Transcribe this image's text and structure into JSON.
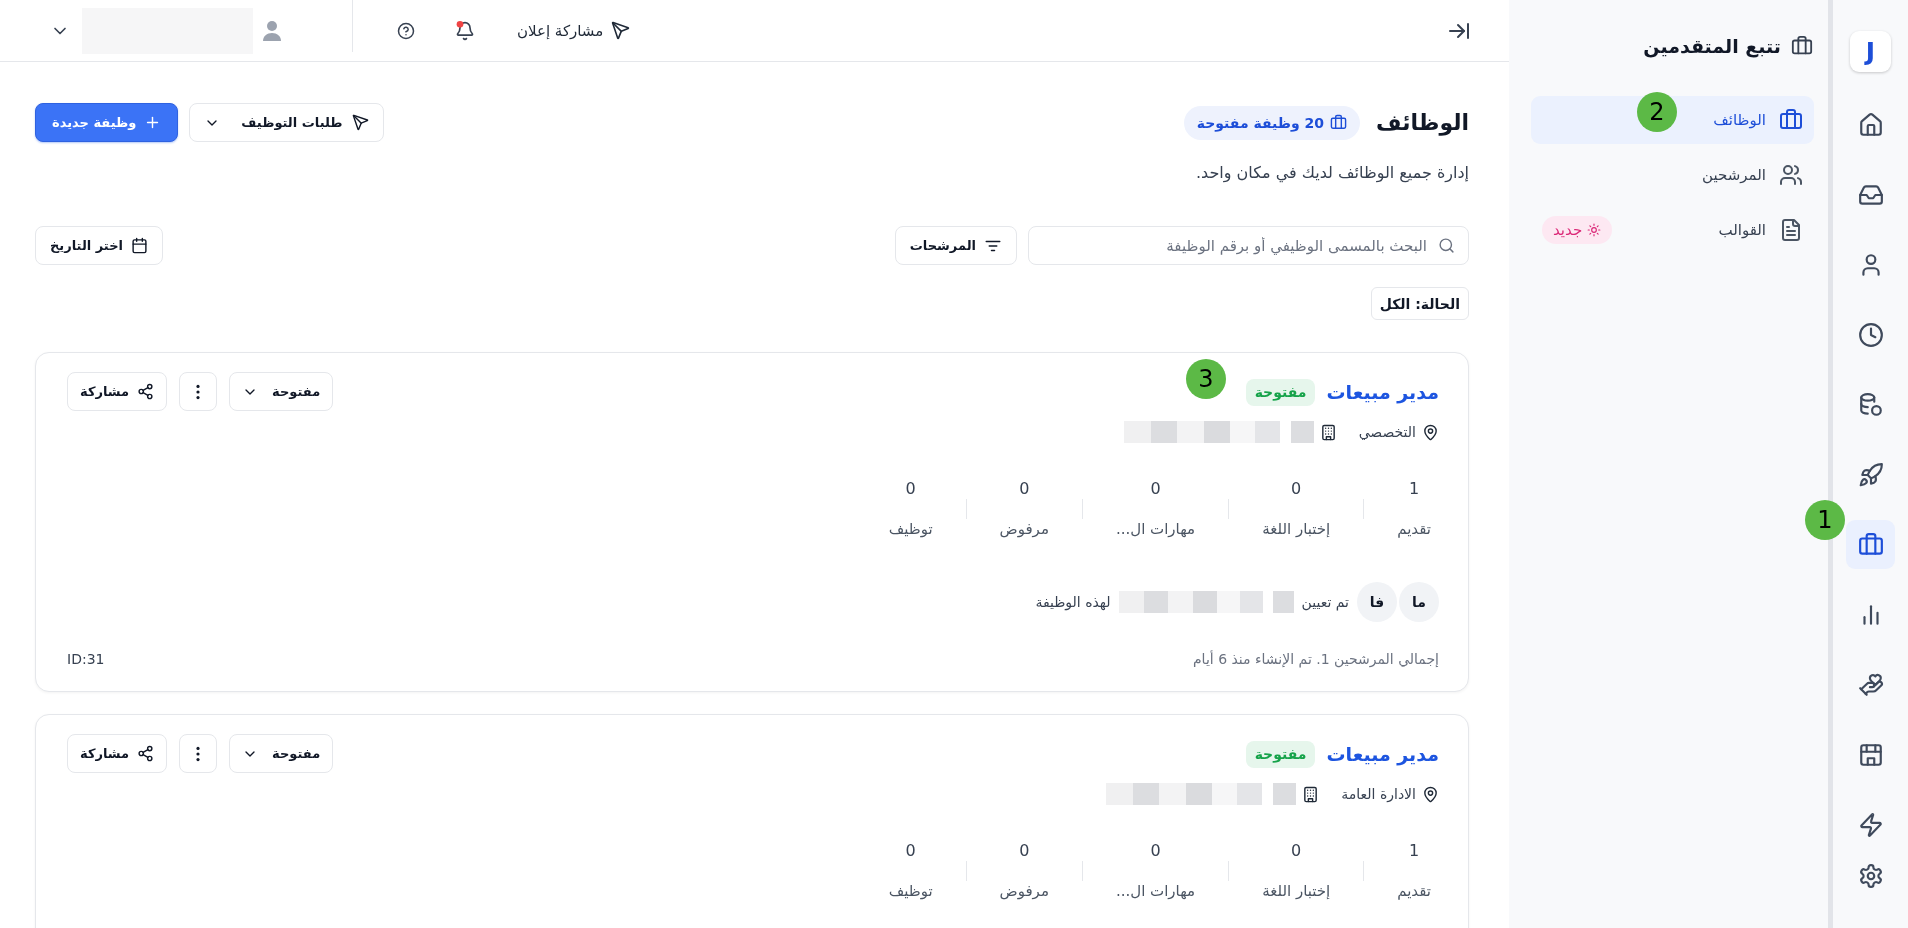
{
  "icon_rail": {
    "logo": "J",
    "items": [
      {
        "kind": "home",
        "selected": false
      },
      {
        "kind": "inbox",
        "selected": false
      },
      {
        "kind": "user",
        "selected": false
      },
      {
        "kind": "clock",
        "selected": false
      },
      {
        "kind": "coins",
        "selected": false
      },
      {
        "kind": "rocket",
        "selected": false
      },
      {
        "kind": "briefcase",
        "selected": true,
        "annotation": "1"
      },
      {
        "kind": "chart",
        "selected": false
      },
      {
        "kind": "hand_heart",
        "selected": false
      },
      {
        "kind": "store",
        "selected": false
      },
      {
        "kind": "zap",
        "selected": false
      }
    ],
    "bottom_items": [
      {
        "kind": "settings",
        "selected": false
      }
    ]
  },
  "sidebar": {
    "title": "تتبع المتقدمين",
    "items": [
      {
        "kind": "briefcase",
        "label": "الوظائف",
        "selected": true,
        "annotation": "2"
      },
      {
        "kind": "users",
        "label": "المرشحين",
        "selected": false
      },
      {
        "kind": "file",
        "label": "القوالب",
        "selected": false,
        "badge": "جديد"
      }
    ]
  },
  "top_bar": {
    "share_ad": "مشاركة إعلان",
    "notifications_unread": true
  },
  "page_header": {
    "title": "الوظائف",
    "open_jobs": "20 وظيفة مفتوحة",
    "subtitle": "إدارة جميع الوظائف لديك في مكان واحد.",
    "buttons": [
      {
        "kind": "dropdown",
        "label": "طلبات التوظيف"
      },
      {
        "kind": "primary",
        "label": "وظيفة جديدة"
      }
    ]
  },
  "filters": {
    "search": {
      "placeholder": "البحث بالمسمى الوظيفي أو برقم الوظيفة"
    },
    "filters_button": "المرشحات",
    "date_button": "اختر التاريخ",
    "status": "الحالة: الكل"
  },
  "jobs": [
    {
      "title": "مدير مبيعات",
      "status": "مفتوحة",
      "location": "التخصصي",
      "status_select": "مفتوحة",
      "share": "مشاركة",
      "stages": [
        {
          "value": "1",
          "label": "تقديم"
        },
        {
          "value": "0",
          "label": "إختبار اللغة"
        },
        {
          "value": "0",
          "label": "مهارات ال..."
        },
        {
          "value": "0",
          "label": "مرفوض"
        },
        {
          "value": "0",
          "label": "توظيف"
        }
      ],
      "assignees": [
        "ما",
        "فا"
      ],
      "assigned_before": "تم تعيين",
      "assigned_after": "لهذه الوظيفة",
      "summary": "إجمالي المرشحين 1. تم الإنشاء منذ 6 أيام",
      "id": "ID:31",
      "annotation": "3"
    },
    {
      "title": "مدير مبيعات",
      "status": "مفتوحة",
      "location": "الادارة العامة",
      "status_select": "مفتوحة",
      "share": "مشاركة",
      "stages": [
        {
          "value": "1",
          "label": "تقديم"
        },
        {
          "value": "0",
          "label": "إختبار اللغة"
        },
        {
          "value": "0",
          "label": "مهارات ال..."
        },
        {
          "value": "0",
          "label": "مرفوض"
        },
        {
          "value": "0",
          "label": "توظيف"
        }
      ]
    }
  ]
}
